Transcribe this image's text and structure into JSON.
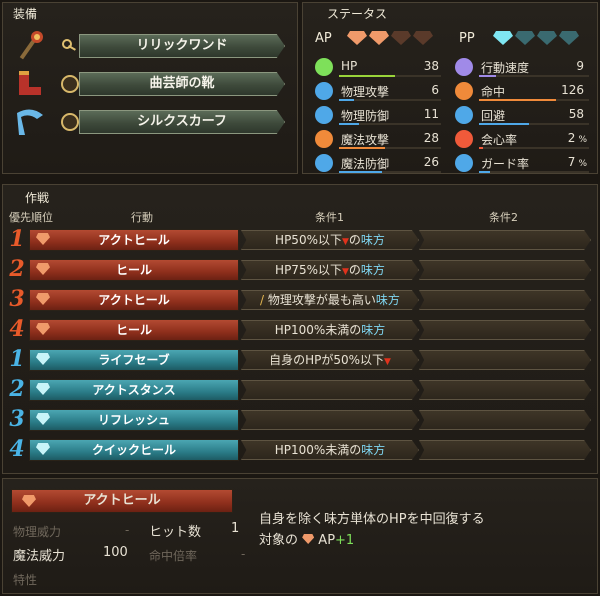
{
  "equipment": {
    "title": "装備",
    "items": [
      {
        "name": "リリックワンド"
      },
      {
        "name": "曲芸師の靴"
      },
      {
        "name": "シルクスカーフ"
      }
    ]
  },
  "status": {
    "title": "ステータス",
    "ap_label": "AP",
    "pp_label": "PP",
    "ap_gems": [
      "#f09a6a",
      "#f09a6a",
      "#5a3a2a",
      "#5a3a2a"
    ],
    "pp_gems": [
      "#7fe6f2",
      "#3a6a70",
      "#3a6a70",
      "#3a6a70"
    ],
    "left": [
      {
        "label": "HP",
        "value": "38",
        "icon": "heart-icon",
        "color": "#7ee05a",
        "fill": 0.55,
        "bar": "#9ad43a"
      },
      {
        "label": "物理攻撃",
        "value": "6",
        "icon": "sword-icon",
        "color": "#4fa8e8",
        "fill": 0.15,
        "bar": "#4fa8e8"
      },
      {
        "label": "物理防御",
        "value": "11",
        "icon": "armor-icon",
        "color": "#4fa8e8",
        "fill": 0.2,
        "bar": "#4fa8e8"
      },
      {
        "label": "魔法攻撃",
        "value": "28",
        "icon": "wand-icon",
        "color": "#f08a3a",
        "fill": 0.45,
        "bar": "#f08a3a"
      },
      {
        "label": "魔法防御",
        "value": "26",
        "icon": "robe-icon",
        "color": "#4fa8e8",
        "fill": 0.42,
        "bar": "#4fa8e8"
      }
    ],
    "right": [
      {
        "label": "行動速度",
        "value": "9",
        "pct": "",
        "icon": "speed-icon",
        "color": "#a08ae8",
        "fill": 0.15,
        "bar": "#a08ae8"
      },
      {
        "label": "命中",
        "value": "126",
        "pct": "",
        "icon": "target-icon",
        "color": "#f08a3a",
        "fill": 0.7,
        "bar": "#f08a3a"
      },
      {
        "label": "回避",
        "value": "58",
        "pct": "",
        "icon": "evade-icon",
        "color": "#4fa8e8",
        "fill": 0.45,
        "bar": "#4fa8e8"
      },
      {
        "label": "会心率",
        "value": "2",
        "pct": "%",
        "icon": "critical-icon",
        "color": "#f05a3a",
        "fill": 0.04,
        "bar": "#f05a3a"
      },
      {
        "label": "ガード率",
        "value": "7",
        "pct": "%",
        "icon": "shield-icon",
        "color": "#4fa8e8",
        "fill": 0.1,
        "bar": "#4fa8e8"
      }
    ]
  },
  "tactics": {
    "title": "作戦",
    "col_priority": "優先順位",
    "col_action": "行動",
    "col_cond1": "条件1",
    "col_cond2": "条件2",
    "rows": [
      {
        "num": "1",
        "action": "アクトヒール",
        "kind": "red",
        "c1a": "HP50%以下",
        "c1tri": "▼",
        "c1b": "の",
        "c1c": "味方"
      },
      {
        "num": "2",
        "action": "ヒール",
        "kind": "red",
        "c1a": "HP75%以下",
        "c1tri": "▼",
        "c1b": "の",
        "c1c": "味方"
      },
      {
        "num": "3",
        "action": "アクトヒール",
        "kind": "red",
        "c1sw": "/",
        "c1a": " 物理攻撃が最も高い",
        "c1tri": "",
        "c1b": "",
        "c1c": "味方"
      },
      {
        "num": "4",
        "action": "ヒール",
        "kind": "red",
        "c1a": "HP100%未満の",
        "c1tri": "",
        "c1b": "",
        "c1c": "味方"
      },
      {
        "num": "1",
        "action": "ライフセーブ",
        "kind": "teal",
        "c1a": "自身のHPが50%以下",
        "c1tri": "▼",
        "c1b": "",
        "c1c": ""
      },
      {
        "num": "2",
        "action": "アクトスタンス",
        "kind": "teal",
        "c1a": "",
        "c1tri": "",
        "c1b": "",
        "c1c": ""
      },
      {
        "num": "3",
        "action": "リフレッシュ",
        "kind": "teal",
        "c1a": "",
        "c1tri": "",
        "c1b": "",
        "c1c": ""
      },
      {
        "num": "4",
        "action": "クイックヒール",
        "kind": "teal",
        "c1a": "HP100%未満の",
        "c1tri": "",
        "c1b": "",
        "c1c": "味方"
      }
    ]
  },
  "detail": {
    "action": "アクトヒール",
    "phys_power_label": "物理威力",
    "phys_power_value": "-",
    "hits_label": "ヒット数",
    "hits_value": "1",
    "mag_power_label": "魔法威力",
    "mag_power_value": "100",
    "hit_mult_label": "命中倍率",
    "hit_mult_value": "-",
    "trait_label": "特性",
    "desc_line1": "自身を除く味方単体のHPを中回復する",
    "desc_line2a": "対象の",
    "desc_line2b": "AP",
    "desc_line2c": "+1"
  }
}
